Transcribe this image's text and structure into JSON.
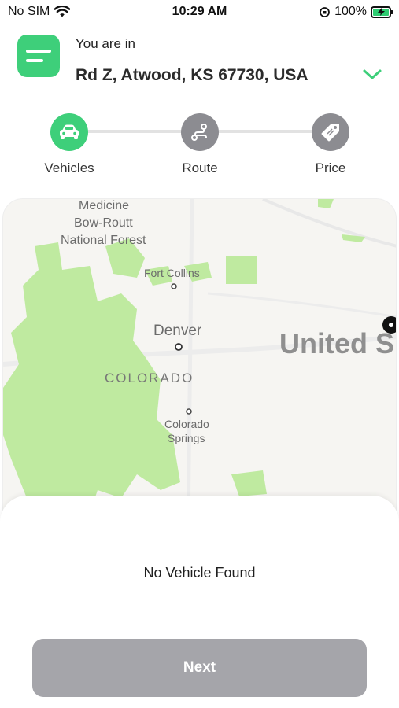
{
  "status_bar": {
    "carrier": "No SIM",
    "time": "10:29 AM",
    "battery": "100%",
    "icons": [
      "wifi-icon",
      "orientation-lock-icon",
      "battery-charging-icon"
    ]
  },
  "header": {
    "label": "You are in",
    "location": "Rd Z, Atwood, KS 67730, USA",
    "icons": [
      "menu-icon",
      "chevron-down-icon"
    ]
  },
  "steps": [
    {
      "label": "Vehicles",
      "icon": "car-icon",
      "state": "active"
    },
    {
      "label": "Route",
      "icon": "route-icon",
      "state": "inactive"
    },
    {
      "label": "Price",
      "icon": "tag-icon",
      "state": "inactive"
    }
  ],
  "map": {
    "labels": {
      "medicine": "Medicine",
      "bow_routt": "Bow-Routt",
      "national_forest": "National Forest",
      "fort_collins": "Fort Collins",
      "denver": "Denver",
      "colorado": "COLORADO",
      "colorado_springs_1": "Colorado",
      "colorado_springs_2": "Springs",
      "united_states": "United S"
    }
  },
  "sheet": {
    "empty_message": "No Vehicle Found",
    "next_label": "Next"
  },
  "colors": {
    "accent": "#3ecf7a",
    "inactive_step": "#8c8c91",
    "disabled_button": "#a5a5aa",
    "map_park": "#bfeaa0"
  }
}
